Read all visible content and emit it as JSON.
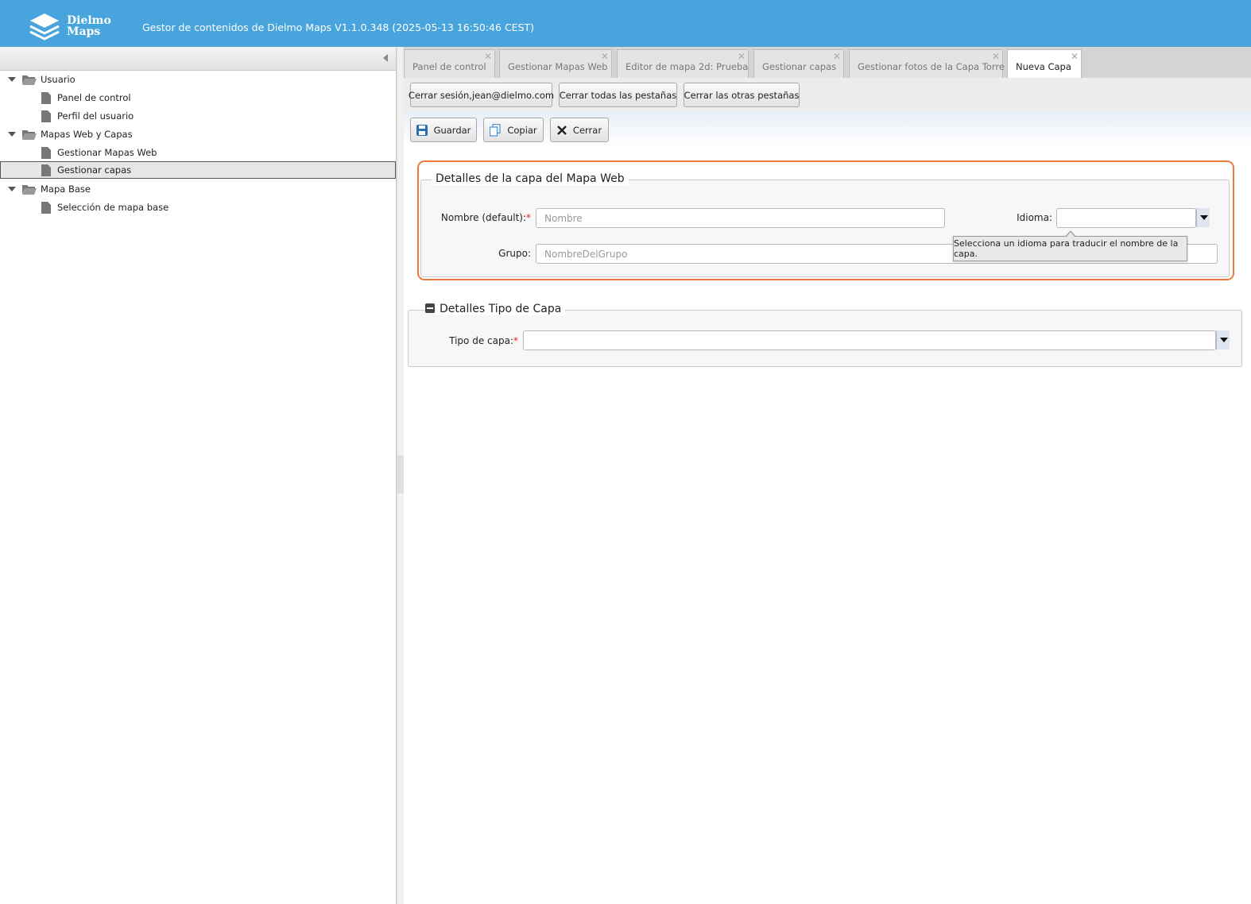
{
  "header": {
    "logo_line1": "Dielmo",
    "logo_line2": "Maps",
    "title": "Gestor de contenidos de Dielmo Maps V1.1.0.348 (2025-05-13 16:50:46 CEST)"
  },
  "sidebar": {
    "groups": [
      {
        "label": "Usuario",
        "items": [
          "Panel de control",
          "Perfil del usuario"
        ]
      },
      {
        "label": "Mapas Web y Capas",
        "items": [
          "Gestionar Mapas Web",
          "Gestionar capas"
        ]
      },
      {
        "label": "Mapa Base",
        "items": [
          "Selección de mapa base"
        ]
      }
    ],
    "selected": "Gestionar capas"
  },
  "tabs": [
    {
      "label": "Panel de control",
      "active": false
    },
    {
      "label": "Gestionar Mapas Web",
      "active": false
    },
    {
      "label": "Editor de mapa 2d: Prueba",
      "active": false
    },
    {
      "label": "Gestionar capas",
      "active": false
    },
    {
      "label": "Gestionar fotos de la Capa Torre",
      "active": false
    },
    {
      "label": "Nueva Capa",
      "active": true
    }
  ],
  "session_toolbar": {
    "logout": "Cerrar sesión,jean@dielmo.com",
    "close_all": "Cerrar todas las pestañas",
    "close_others": "Cerrar las otras pestañas"
  },
  "action_toolbar": {
    "save": "Guardar",
    "copy": "Copiar",
    "close": "Cerrar"
  },
  "layer_details": {
    "legend": "Detalles de la capa del Mapa Web",
    "name_label": "Nombre (default):",
    "required_mark": "*",
    "name_placeholder": "Nombre",
    "name_value": "",
    "language_label": "Idioma:",
    "language_value": "",
    "group_label": "Grupo:",
    "group_placeholder": "NombreDelGrupo",
    "group_value": "",
    "tooltip": "Selecciona un idioma para traducir el nombre de la capa."
  },
  "layer_type": {
    "legend": "Detalles Tipo de Capa",
    "type_label": "Tipo de capa:",
    "required_mark": "*",
    "type_value": ""
  },
  "colors": {
    "header": "#48a4dc",
    "highlight": "#ee7a3c",
    "required": "#e02020"
  }
}
